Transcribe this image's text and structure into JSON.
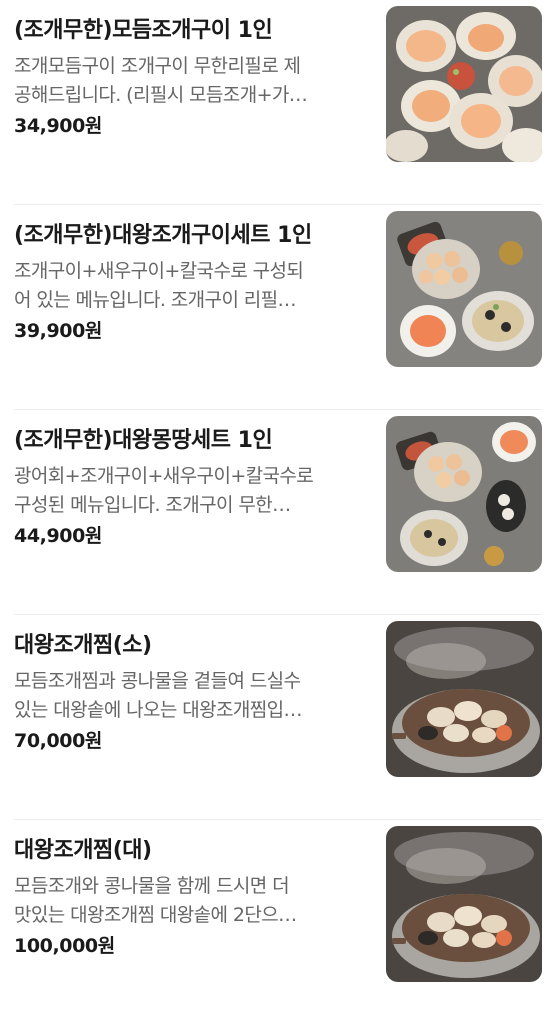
{
  "menu": {
    "items": [
      {
        "title": "(조개무한)모듬조개구이 1인",
        "desc_line1": "조개모듬구이 조개구이 무한리필로 제",
        "desc_line2": "공해드립니다. (리필시 모듬조개+가…",
        "price": "34,900원",
        "photo_icon": "scallop-platter-photo"
      },
      {
        "title": "(조개무한)대왕조개구이세트 1인",
        "desc_line1": "조개구이+새우구이+칼국수로 구성되",
        "desc_line2": "어 있는 메뉴입니다. 조개구이 리필…",
        "price": "39,900원",
        "photo_icon": "seafood-set-photo"
      },
      {
        "title": "(조개무한)대왕몽땅세트 1인",
        "desc_line1": "광어회+조개구이+새우구이+칼국수로",
        "desc_line2": "구성된 메뉴입니다. 조개구이 무한…",
        "price": "44,900원",
        "photo_icon": "seafood-set-photo"
      },
      {
        "title": "대왕조개찜(소)",
        "desc_line1": "모듬조개찜과 콩나물을 곁들여 드실수",
        "desc_line2": "있는 대왕솥에 나오는 대왕조개찜입…",
        "price": "70,000원",
        "photo_icon": "steamed-clam-pot-photo"
      },
      {
        "title": "대왕조개찜(대)",
        "desc_line1": "모듬조개와 콩나물을 함께 드시면 더",
        "desc_line2": "맛있는 대왕조개찜 대왕솥에 2단으…",
        "price": "100,000원",
        "photo_icon": "steamed-clam-pot-photo"
      }
    ]
  }
}
